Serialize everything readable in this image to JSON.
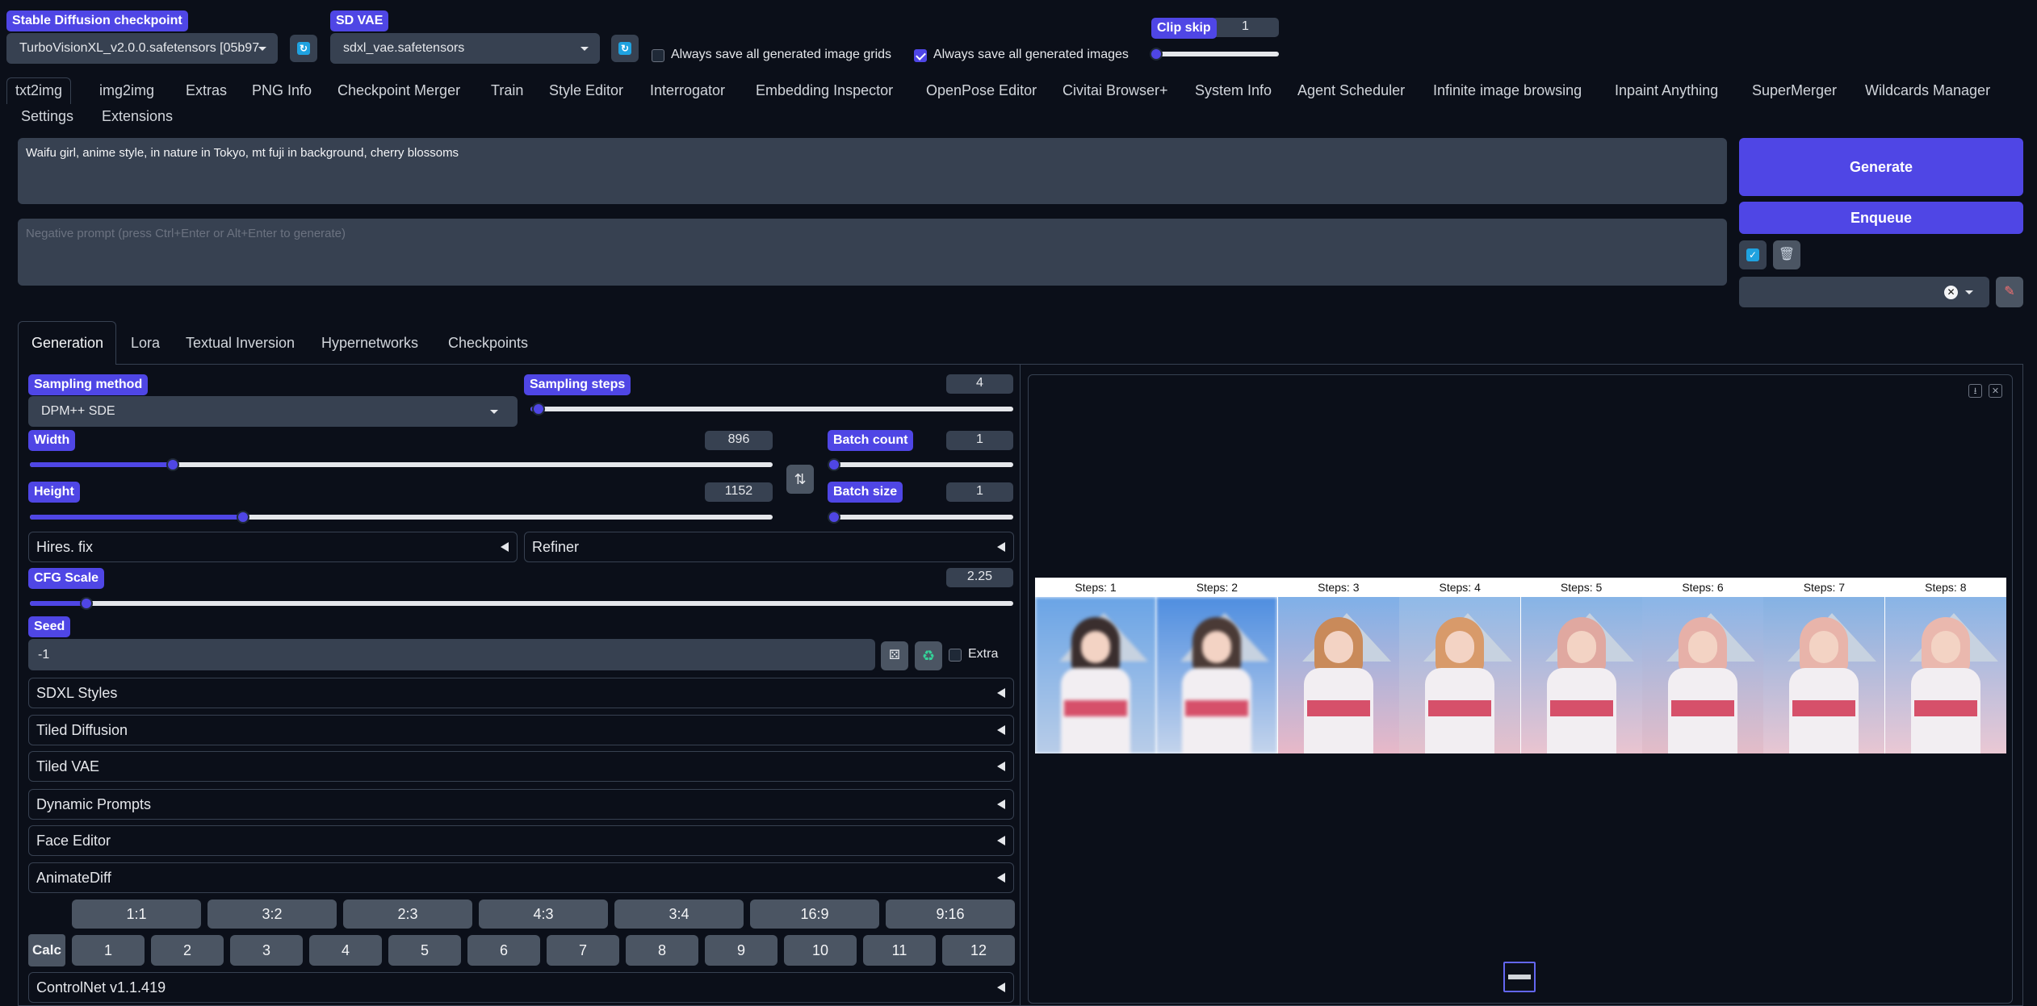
{
  "top": {
    "checkpoint_label": "Stable Diffusion checkpoint",
    "checkpoint_value": "TurboVisionXL_v2.0.0.safetensors [05b97",
    "vae_label": "SD VAE",
    "vae_value": "sdxl_vae.safetensors",
    "save_grids_label": "Always save all generated image grids",
    "save_images_label": "Always save all generated images",
    "clip_skip_label": "Clip skip",
    "clip_skip_value": "1"
  },
  "tabs_row1": [
    "txt2img",
    "img2img",
    "Extras",
    "PNG Info",
    "Checkpoint Merger",
    "Train",
    "Style Editor",
    "Interrogator",
    "Embedding Inspector",
    "OpenPose Editor",
    "Civitai Browser+",
    "System Info",
    "Agent Scheduler",
    "Infinite image browsing",
    "Inpaint Anything",
    "SuperMerger",
    "Wildcards Manager"
  ],
  "tabs_row2": [
    "Settings",
    "Extensions"
  ],
  "prompt": {
    "positive": "Waifu girl, anime style, in nature in Tokyo, mt fuji in background, cherry blossoms",
    "negative_placeholder": "Negative prompt (press Ctrl+Enter or Alt+Enter to generate)"
  },
  "actions": {
    "generate": "Generate",
    "enqueue": "Enqueue"
  },
  "subtabs": [
    "Generation",
    "Lora",
    "Textual Inversion",
    "Hypernetworks",
    "Checkpoints"
  ],
  "params": {
    "sampling_method_label": "Sampling method",
    "sampling_method_value": "DPM++ SDE",
    "sampling_steps_label": "Sampling steps",
    "sampling_steps_value": "4",
    "width_label": "Width",
    "width_value": "896",
    "height_label": "Height",
    "height_value": "1152",
    "batch_count_label": "Batch count",
    "batch_count_value": "1",
    "batch_size_label": "Batch size",
    "batch_size_value": "1",
    "hires_label": "Hires. fix",
    "refiner_label": "Refiner",
    "cfg_label": "CFG Scale",
    "cfg_value": "2.25",
    "seed_label": "Seed",
    "seed_value": "-1",
    "extra_label": "Extra"
  },
  "accordions": [
    "SDXL Styles",
    "Tiled Diffusion",
    "Tiled VAE",
    "Dynamic Prompts",
    "Face Editor",
    "AnimateDiff"
  ],
  "ratios": [
    "1:1",
    "3:2",
    "2:3",
    "4:3",
    "3:4",
    "16:9",
    "9:16"
  ],
  "calc_label": "Calc",
  "numbers": [
    "1",
    "2",
    "3",
    "4",
    "5",
    "6",
    "7",
    "8",
    "9",
    "10",
    "11",
    "12"
  ],
  "controlnet_label": "ControlNet v1.1.419",
  "gallery_labels": [
    "Steps: 1",
    "Steps: 2",
    "Steps: 3",
    "Steps: 4",
    "Steps: 5",
    "Steps: 6",
    "Steps: 7",
    "Steps: 8"
  ]
}
